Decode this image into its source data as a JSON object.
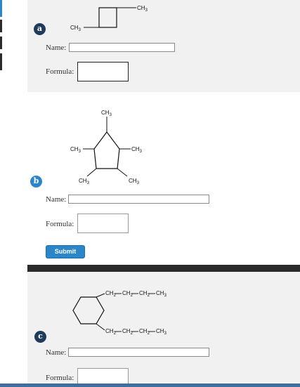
{
  "labels": {
    "name": "Name:",
    "formula": "Formula:"
  },
  "problems": [
    {
      "badge": "a",
      "groups": {
        "ch3_top": "CH",
        "ch3_top_sub": "3",
        "ch3_left": "CH",
        "ch3_left_sub": "3"
      }
    },
    {
      "badge": "b",
      "groups": {
        "top": "CH",
        "top_sub": "3",
        "left": "CH",
        "left_sub": "3",
        "right": "CH",
        "right_sub": "3",
        "bl": "CH",
        "bl_sub": "3",
        "br": "CH",
        "br_sub": "3"
      }
    },
    {
      "badge": "c",
      "chain_top": [
        "CH",
        "2",
        "CH",
        "2",
        "CH",
        "2",
        "CH",
        "3"
      ],
      "chain_bottom": [
        "CH",
        "2",
        "CH",
        "2",
        "CH",
        "2",
        "CH",
        "3"
      ]
    }
  ],
  "submit_label": "Submit",
  "colors": {
    "badge": "#1f3a5a",
    "badge_b": "#2a86c8",
    "accent": "#2a86c8",
    "dark_bar": "#2b2b2b",
    "section_bg": "#f1f1f1"
  }
}
